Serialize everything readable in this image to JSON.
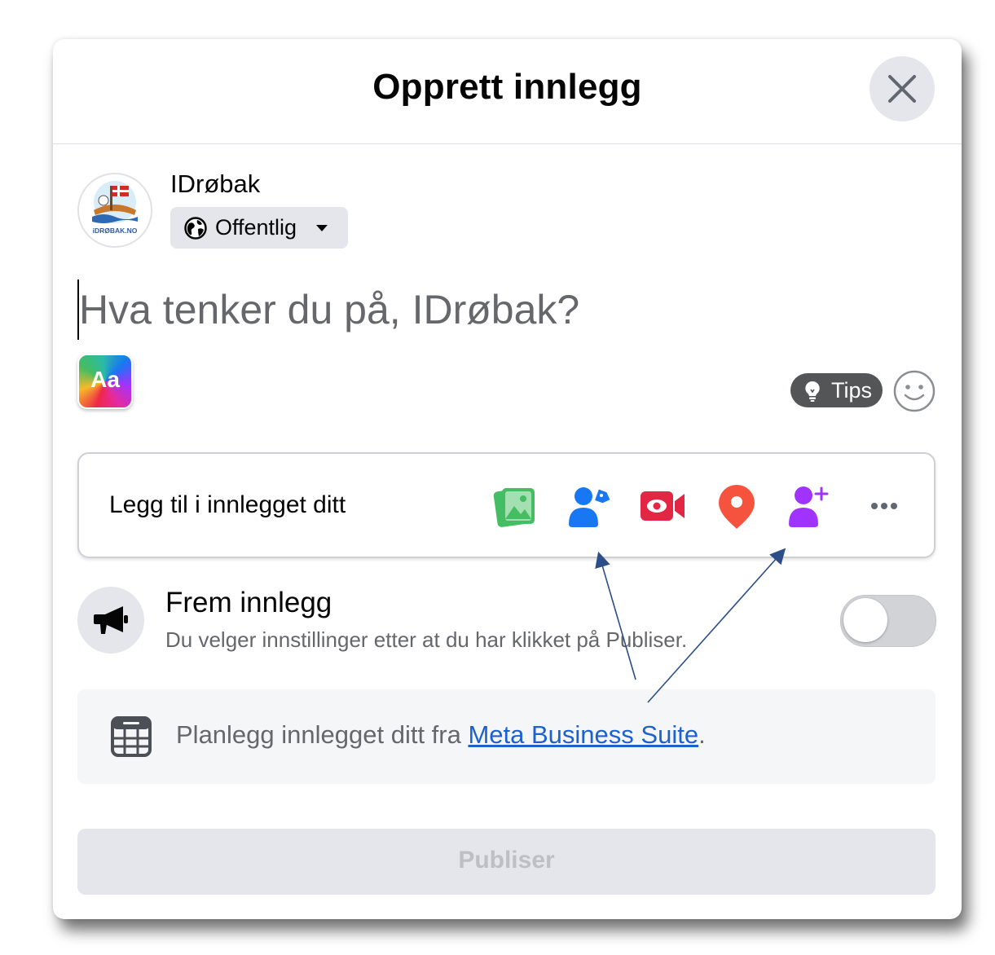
{
  "dialog": {
    "title": "Opprett innlegg",
    "close_icon": "close-icon"
  },
  "author": {
    "name": "IDrøbak",
    "avatar_text": "iDRØBAK.NO",
    "audience": "Offentlig",
    "audience_icon": "globe-icon"
  },
  "composer": {
    "placeholder": "Hva tenker du på, IDrøbak?",
    "value": "",
    "background_picker_label": "Aa",
    "tips_label": "Tips"
  },
  "add_to_post": {
    "label": "Legg til i innlegget ditt",
    "icons": [
      {
        "name": "photo-video-icon",
        "color": "#45bd62"
      },
      {
        "name": "tag-people-icon",
        "color": "#1877f2"
      },
      {
        "name": "live-video-icon",
        "color": "#e42645"
      },
      {
        "name": "check-in-icon",
        "color": "#f5533d"
      },
      {
        "name": "add-collaborator-icon",
        "color": "#a033ff"
      },
      {
        "name": "more-icon",
        "color": "#606770"
      }
    ]
  },
  "boost": {
    "title": "Frem innlegg",
    "description": "Du velger innstillinger etter at du har klikket på Publiser.",
    "toggle_on": false
  },
  "schedule": {
    "text_before": "Planlegg innlegget ditt fra ",
    "link": "Meta Business Suite",
    "text_after": "."
  },
  "publish": {
    "label": "Publiser",
    "enabled": false
  },
  "colors": {
    "link": "#1b61d1",
    "annotation_arrow": "#2b4f86"
  }
}
